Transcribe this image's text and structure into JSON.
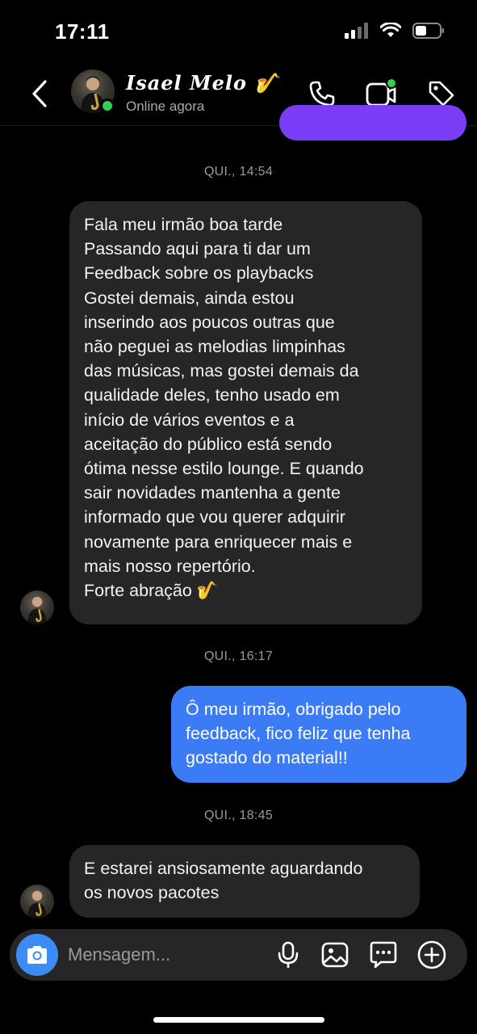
{
  "status_bar": {
    "time": "17:11"
  },
  "header": {
    "contact_name": "Isael Melo 🎷",
    "contact_status": "Online agora"
  },
  "messages": [
    {
      "timestamp": "QUI., 14:54"
    },
    {
      "direction": "incoming",
      "lines": [
        "Fala meu irmão boa tarde",
        "Passando aqui para ti dar um",
        "Feedback sobre os playbacks",
        "Gostei demais, ainda estou",
        "inserindo aos poucos outras que",
        "não peguei as melodias limpinhas",
        "das músicas, mas gostei demais da",
        "qualidade deles, tenho usado em",
        "início de vários eventos e a",
        "aceitação do público está sendo",
        "ótima nesse estilo lounge. E quando",
        "sair novidades mantenha a gente",
        "informado que vou querer adquirir",
        "novamente para enriquecer mais e",
        "mais nosso repertório.",
        "Forte abração 🎷"
      ]
    },
    {
      "timestamp": "QUI., 16:17"
    },
    {
      "direction": "outgoing",
      "lines": [
        "Ô meu irmão, obrigado pelo",
        "feedback, fico feliz que tenha",
        "gostado do material!!"
      ]
    },
    {
      "timestamp": "QUI., 18:45"
    },
    {
      "direction": "incoming",
      "lines": [
        "E estarei ansiosamente aguardando",
        "os novos pacotes"
      ]
    }
  ],
  "composer": {
    "placeholder": "Mensagem..."
  },
  "colors": {
    "outgoing_bubble": "#3b7cf6",
    "incoming_bubble": "#262626",
    "partial_sent_bubble": "#7a3cf4",
    "online": "#36d04f",
    "camera_button": "#3b8cf5"
  },
  "icons": [
    "back-chevron-icon",
    "phone-icon",
    "video-call-icon",
    "tag-icon",
    "camera-icon",
    "microphone-icon",
    "gallery-icon",
    "sticker-icon",
    "plus-icon",
    "signal-icon",
    "wifi-icon",
    "battery-icon"
  ]
}
